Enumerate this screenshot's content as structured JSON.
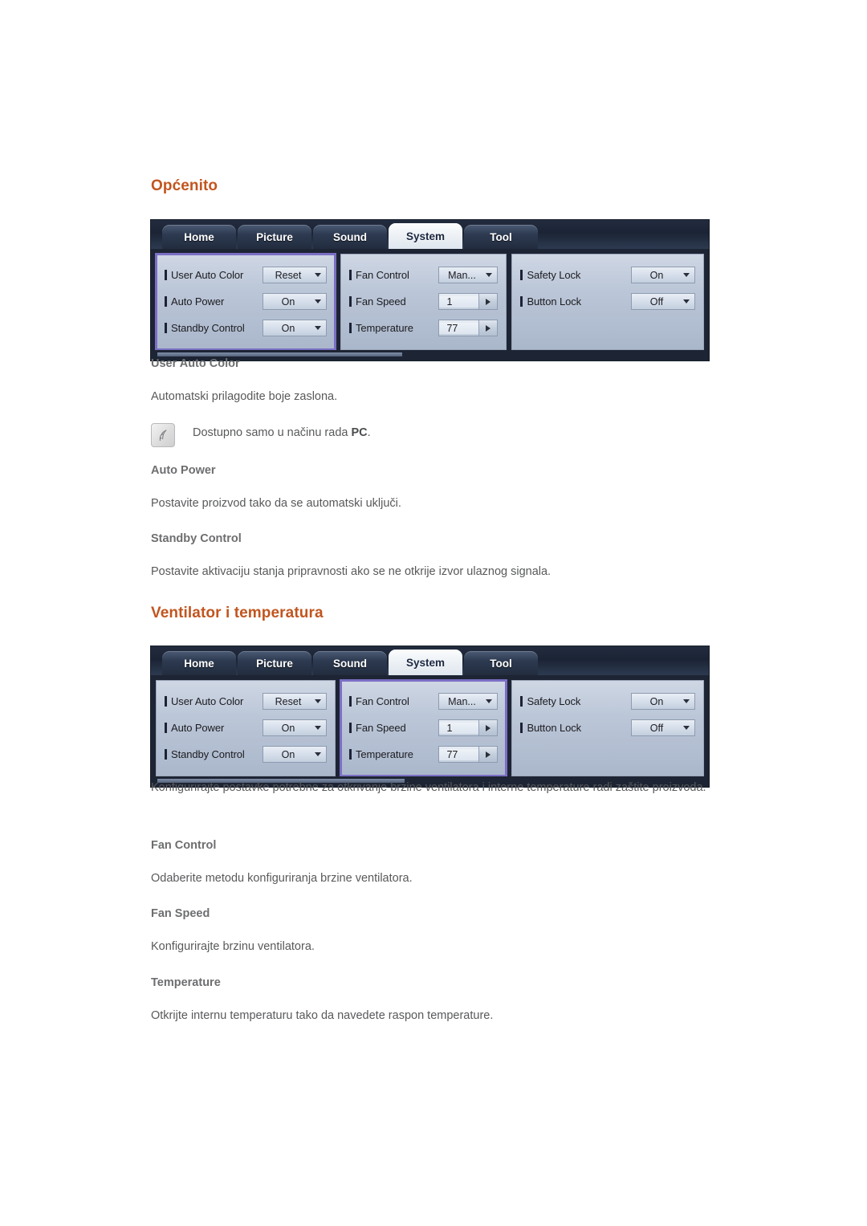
{
  "sections": [
    {
      "heading": "Općenito",
      "osd": {
        "tabs": [
          {
            "label": "Home",
            "active": false
          },
          {
            "label": "Picture",
            "active": false
          },
          {
            "label": "Sound",
            "active": false
          },
          {
            "label": "System",
            "active": true
          },
          {
            "label": "Tool",
            "active": false
          }
        ],
        "highlighted_panel": 1,
        "panels": [
          {
            "rows": [
              {
                "label": "User Auto Color",
                "value": "Reset",
                "control": "dropdown"
              },
              {
                "label": "Auto Power",
                "value": "On",
                "control": "dropdown"
              },
              {
                "label": "Standby Control",
                "value": "On",
                "control": "dropdown"
              }
            ]
          },
          {
            "rows": [
              {
                "label": "Fan Control",
                "value": "Man...",
                "control": "dropdown"
              },
              {
                "label": "Fan Speed",
                "value": "1",
                "control": "spinner"
              },
              {
                "label": "Temperature",
                "value": "77",
                "control": "spinner"
              }
            ]
          },
          {
            "rows": [
              {
                "label": "Safety Lock",
                "value": "On",
                "control": "dropdown"
              },
              {
                "label": "Button Lock",
                "value": "Off",
                "control": "dropdown"
              }
            ]
          }
        ]
      },
      "items": [
        {
          "title": "User Auto Color",
          "text": "Automatski prilagodite boje zaslona.",
          "note": {
            "icon": "note-leaf-icon",
            "text_before": "Dostupno samo u načinu rada ",
            "bold": "PC",
            "text_after": "."
          }
        },
        {
          "title": "Auto Power",
          "text": "Postavite proizvod tako da se automatski uključi."
        },
        {
          "title": "Standby Control",
          "text": "Postavite aktivaciju stanja pripravnosti ako se ne otkrije izvor ulaznog signala."
        }
      ]
    },
    {
      "heading": "Ventilator i temperatura",
      "osd": {
        "tabs": [
          {
            "label": "Home",
            "active": false
          },
          {
            "label": "Picture",
            "active": false
          },
          {
            "label": "Sound",
            "active": false
          },
          {
            "label": "System",
            "active": true
          },
          {
            "label": "Tool",
            "active": false
          }
        ],
        "highlighted_panel": 2,
        "panels": [
          {
            "rows": [
              {
                "label": "User Auto Color",
                "value": "Reset",
                "control": "dropdown"
              },
              {
                "label": "Auto Power",
                "value": "On",
                "control": "dropdown"
              },
              {
                "label": "Standby Control",
                "value": "On",
                "control": "dropdown"
              }
            ]
          },
          {
            "rows": [
              {
                "label": "Fan Control",
                "value": "Man...",
                "control": "dropdown"
              },
              {
                "label": "Fan Speed",
                "value": "1",
                "control": "spinner"
              },
              {
                "label": "Temperature",
                "value": "77",
                "control": "spinner"
              }
            ]
          },
          {
            "rows": [
              {
                "label": "Safety Lock",
                "value": "On",
                "control": "dropdown"
              },
              {
                "label": "Button Lock",
                "value": "Off",
                "control": "dropdown"
              }
            ]
          }
        ]
      },
      "intro": "Konfigurirajte postavke potrebne za otkrivanje brzine ventilatora i interne temperature radi zaštite proizvoda.",
      "items": [
        {
          "title": "Fan Control",
          "text": "Odaberite metodu konfiguriranja brzine ventilatora."
        },
        {
          "title": "Fan Speed",
          "text": "Konfigurirajte brzinu ventilatora."
        },
        {
          "title": "Temperature",
          "text": "Otkrijte internu temperaturu tako da navedete raspon temperature."
        }
      ]
    }
  ],
  "colors": {
    "heading": "#c2551f",
    "subheading": "#6d6e70",
    "body": "#58595b",
    "osd_frame": "#1d2433",
    "osd_panel": "#bcc7d8",
    "highlight": "#7b6fc4"
  }
}
